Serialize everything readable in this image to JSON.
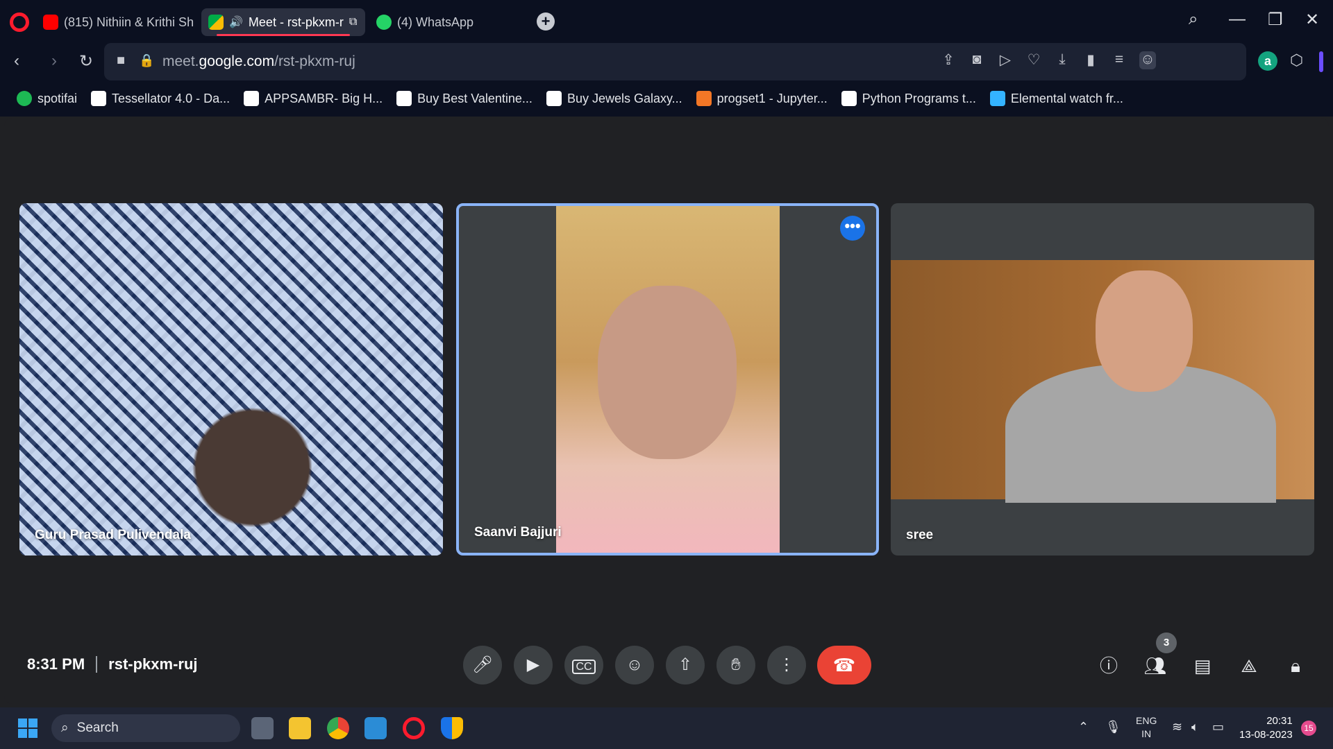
{
  "browser": {
    "tabs": [
      {
        "label": "(815) Nithiin & Krithi Sh",
        "icon": "youtube-icon"
      },
      {
        "label": "Meet - rst-pkxm-r",
        "icon": "google-meet-icon",
        "active": true
      },
      {
        "label": "(4) WhatsApp",
        "icon": "whatsapp-icon"
      }
    ],
    "url_prefix": "meet.",
    "url_domain": "google.com",
    "url_path": "/rst-pkxm-ruj"
  },
  "bookmarks": [
    {
      "label": "spotifai",
      "color": "#1db954"
    },
    {
      "label": "Tessellator 4.0 - Da...",
      "color": "#ffffff"
    },
    {
      "label": "APPSAMBR- Big H...",
      "color": "#ffffff"
    },
    {
      "label": "Buy Best Valentine...",
      "color": "#ffffff"
    },
    {
      "label": "Buy Jewels Galaxy...",
      "color": "#ffffff"
    },
    {
      "label": "progset1 - Jupyter...",
      "color": "#f37726"
    },
    {
      "label": "Python Programs t...",
      "color": "#ffffff"
    },
    {
      "label": "Elemental watch fr...",
      "color": "#34b3ff"
    }
  ],
  "participants": [
    {
      "name": "Guru Prasad Pulivendala"
    },
    {
      "name": "Saanvi Bajjuri",
      "speaking": true
    },
    {
      "name": "sree"
    }
  ],
  "meeting": {
    "time": "8:31 PM",
    "code": "rst-pkxm-ruj",
    "participant_count": "3"
  },
  "taskbar": {
    "search_placeholder": "Search",
    "lang_top": "ENG",
    "lang_bottom": "IN",
    "time": "20:31",
    "date": "13-08-2023",
    "notifications": "15"
  },
  "colors": {
    "hangup": "#ea4335",
    "speaking_border": "#8ab4f8",
    "opera_red": "#ff1b2d"
  }
}
